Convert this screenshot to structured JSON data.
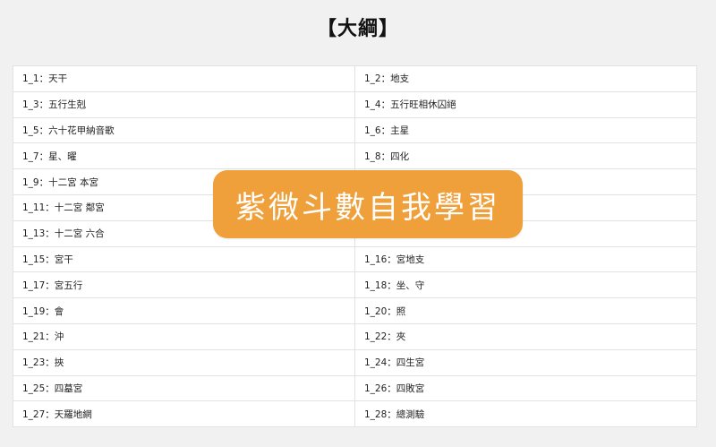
{
  "title": "【大綱】",
  "badge": "紫微斗數自我學習",
  "colors": {
    "badge": "#f0a03a",
    "background": "#f1f1f1",
    "table": "#ffffff"
  },
  "items": [
    [
      "1_1：天干",
      "1_2：地支"
    ],
    [
      "1_3：五行生剋",
      "1_4：五行旺相休囚絕"
    ],
    [
      "1_5：六十花甲納音歌",
      "1_6：主星"
    ],
    [
      "1_7：星、曜",
      "1_8：四化"
    ],
    [
      "1_9：十二宮 本宮",
      ""
    ],
    [
      "1_11：十二宮 鄰宮",
      ""
    ],
    [
      "1_13：十二宮 六合",
      ""
    ],
    [
      "1_15：宮干",
      "1_16：宮地支"
    ],
    [
      "1_17：宮五行",
      "1_18：坐、守"
    ],
    [
      "1_19：會",
      "1_20：照"
    ],
    [
      "1_21：沖",
      "1_22：夾"
    ],
    [
      "1_23：挾",
      "1_24：四生宮"
    ],
    [
      "1_25：四墓宮",
      "1_26：四敗宮"
    ],
    [
      "1_27：天羅地網",
      "1_28：總測驗"
    ]
  ]
}
